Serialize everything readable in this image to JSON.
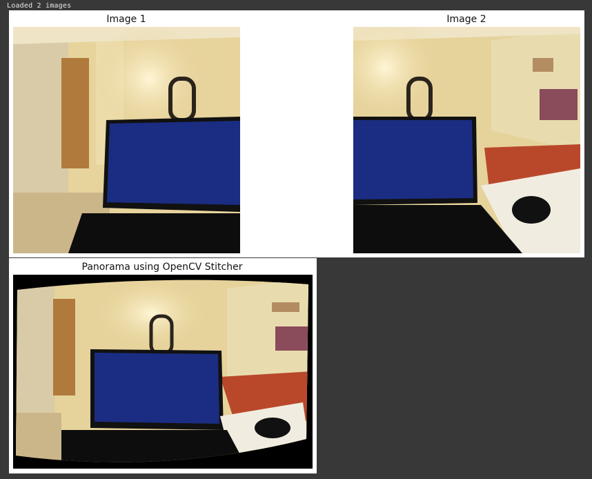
{
  "console": {
    "text": "Loaded 2 images"
  },
  "figure1": {
    "titles": {
      "image1": "Image 1",
      "image2": "Image 2"
    }
  },
  "figure2": {
    "title": "Panorama using OpenCV Stitcher"
  },
  "colors": {
    "background": "#383838",
    "figure": "#ffffff",
    "wall": "#e9d59a",
    "screen": "#1a2f8c",
    "laptop": "#111111",
    "bedspread": "#c0512b"
  }
}
